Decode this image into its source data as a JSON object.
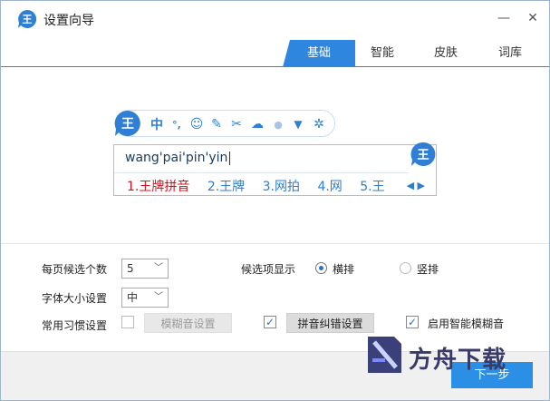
{
  "window": {
    "title": "设置向导",
    "minimize_label": "—",
    "close_label": "✕"
  },
  "tabs": [
    {
      "label": "基础",
      "active": true
    },
    {
      "label": "智能",
      "active": false
    },
    {
      "label": "皮肤",
      "active": false
    },
    {
      "label": "词库",
      "active": false
    }
  ],
  "preview": {
    "toolbar_icons": [
      "ime-logo-icon",
      "chinese-mode-icon",
      "punctuation-icon",
      "emoji-icon",
      "pen-icon",
      "scissors-icon",
      "cloud-icon",
      "user-icon",
      "shirt-icon",
      "gear-icon"
    ],
    "toolbar_glyphs": {
      "chinese": "中",
      "punct": "°,",
      "emoji": "☺",
      "pen": "✎",
      "scissors": "✂",
      "cloud": "☁",
      "user": "●",
      "shirt": "▼",
      "gear": "✲"
    },
    "pinyin": "wang'pai'pin'yin",
    "candidates": [
      "1.王牌拼音",
      "2.王牌",
      "3.网拍",
      "4.网",
      "5.王"
    ],
    "pager": "◀ ▶"
  },
  "settings": {
    "page_size_label": "每页候选个数",
    "page_size_value": "5",
    "font_size_label": "字体大小设置",
    "font_size_value": "中",
    "habits_label": "常用习惯设置",
    "fuzzy_button": "模糊音设置",
    "fuzzy_checked": false,
    "correction_button": "拼音纠错设置",
    "correction_checked": true,
    "smart_fuzzy_label": "启用智能模糊音",
    "smart_fuzzy_checked": true,
    "display_label": "候选项显示",
    "horizontal_label": "横排",
    "vertical_label": "竖排",
    "orientation": "横排"
  },
  "footer": {
    "next_label": "下一步"
  },
  "watermark": {
    "text": "方舟下载"
  },
  "colors": {
    "accent": "#2e86de",
    "candidate_first": "#d0111b",
    "candidate": "#2e7dcd"
  }
}
